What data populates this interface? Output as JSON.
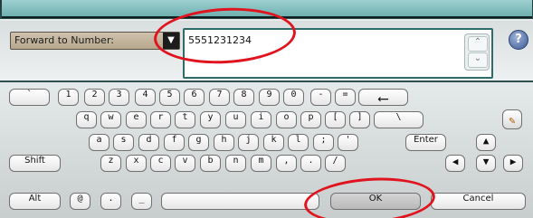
{
  "forward": {
    "label": "Forward to Number:",
    "value": "5551231234",
    "arrow_icon": "triangle-down"
  },
  "help": {
    "label": "?"
  },
  "keyboard": {
    "row1": [
      "`",
      "1",
      "2",
      "3",
      "4",
      "5",
      "6",
      "7",
      "8",
      "9",
      "0",
      "-",
      "="
    ],
    "row2": [
      "q",
      "w",
      "e",
      "r",
      "t",
      "y",
      "u",
      "i",
      "o",
      "p",
      "[",
      "]",
      "\\"
    ],
    "row3": [
      "a",
      "s",
      "d",
      "f",
      "g",
      "h",
      "j",
      "k",
      "l",
      ";",
      "'"
    ],
    "row4": [
      "z",
      "x",
      "c",
      "v",
      "b",
      "n",
      "m",
      ",",
      ".",
      "/"
    ],
    "enter": "Enter",
    "shift": "Shift",
    "alt": "Alt",
    "at": "@",
    "dot": ".",
    "underscore": "_",
    "ok": "OK",
    "cancel": "Cancel"
  },
  "icons": {
    "backspace": "backspace-arrow-icon",
    "clear": "eraser-icon",
    "scroll_up": "chevron-up-icon",
    "scroll_down": "chevron-down-icon",
    "arrow_up": "arrow-up-icon",
    "arrow_left": "arrow-left-icon",
    "arrow_down": "arrow-down-icon",
    "arrow_right": "arrow-right-icon"
  },
  "colors": {
    "annotation": "#e0141e",
    "panel": "#e6eaea",
    "field_border": "#2e6b6b"
  }
}
